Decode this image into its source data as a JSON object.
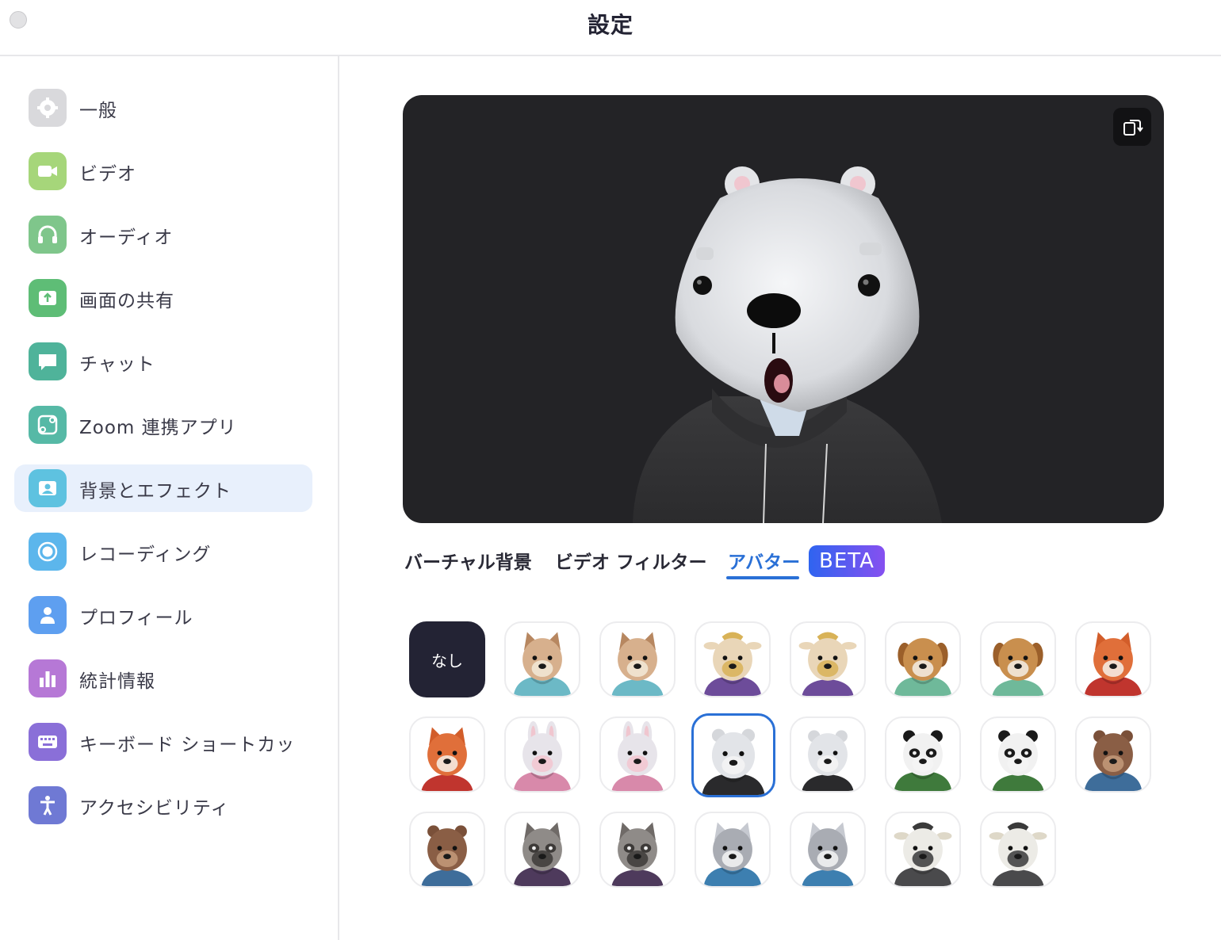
{
  "window": {
    "title": "設定"
  },
  "sidebar": {
    "items": [
      {
        "label": "一般",
        "icon": "gear-icon",
        "color": "#d9d9dc",
        "active": false
      },
      {
        "label": "ビデオ",
        "icon": "video-camera-icon",
        "color": "#a6d67a",
        "active": false
      },
      {
        "label": "オーディオ",
        "icon": "headphones-icon",
        "color": "#7fc68b",
        "active": false
      },
      {
        "label": "画面の共有",
        "icon": "share-screen-icon",
        "color": "#5ebd76",
        "active": false
      },
      {
        "label": "チャット",
        "icon": "chat-bubble-icon",
        "color": "#4fb39a",
        "active": false
      },
      {
        "label": "Zoom 連携アプリ",
        "icon": "apps-icon",
        "color": "#56b9a6",
        "active": false
      },
      {
        "label": "背景とエフェクト",
        "icon": "background-portrait-icon",
        "color": "#5ec2e0",
        "active": true
      },
      {
        "label": "レコーディング",
        "icon": "record-icon",
        "color": "#5cb6ec",
        "active": false
      },
      {
        "label": "プロフィール",
        "icon": "profile-icon",
        "color": "#5e9ff0",
        "active": false
      },
      {
        "label": "統計情報",
        "icon": "statistics-icon",
        "color": "#b678d6",
        "active": false
      },
      {
        "label": "キーボード ショートカッ",
        "icon": "keyboard-icon",
        "color": "#8a6fd8",
        "active": false
      },
      {
        "label": "アクセシビリティ",
        "icon": "accessibility-icon",
        "color": "#6f79d4",
        "active": false
      }
    ]
  },
  "preview": {
    "rotate_icon": "rotate-camera-icon",
    "avatar": "polar-bear-black-hoodie"
  },
  "tabs": [
    {
      "label": "バーチャル背景",
      "active": false
    },
    {
      "label": "ビデオ フィルター",
      "active": false
    },
    {
      "label": "アバター",
      "active": true
    }
  ],
  "beta_badge": "BETA",
  "avatars": {
    "none_label": "なし",
    "items": [
      {
        "name": "cat-teal-hoodie",
        "selected": false
      },
      {
        "name": "cat-blue-shirt",
        "selected": false
      },
      {
        "name": "cow-purple-hoodie",
        "selected": false
      },
      {
        "name": "cow-purple-shirt",
        "selected": false
      },
      {
        "name": "dog-green-hoodie",
        "selected": false
      },
      {
        "name": "dog-green-shirt",
        "selected": false
      },
      {
        "name": "fox-red-hoodie",
        "selected": false
      },
      {
        "name": "fox-red-shirt",
        "selected": false
      },
      {
        "name": "rabbit-pink-hoodie",
        "selected": false
      },
      {
        "name": "rabbit-pink-shirt",
        "selected": false
      },
      {
        "name": "polar-bear-black-hoodie",
        "selected": true
      },
      {
        "name": "polar-bear-black-shirt",
        "selected": false
      },
      {
        "name": "panda-green-hoodie",
        "selected": false
      },
      {
        "name": "panda-green-shirt",
        "selected": false
      },
      {
        "name": "beaver-blue-hoodie",
        "selected": false
      },
      {
        "name": "beaver-blue-shirt",
        "selected": false
      },
      {
        "name": "raccoon-purple-hoodie",
        "selected": false
      },
      {
        "name": "raccoon-purple-shirt",
        "selected": false
      },
      {
        "name": "koala-blue-hoodie",
        "selected": false
      },
      {
        "name": "koala-blue-shirt",
        "selected": false
      },
      {
        "name": "cow-gray-hoodie",
        "selected": false
      },
      {
        "name": "cow-gray-shirt",
        "selected": false
      }
    ]
  },
  "colors": {
    "accent": "#2a70d6",
    "active_nav_bg": "#e8f0fc",
    "preview_bg": "#232326"
  }
}
